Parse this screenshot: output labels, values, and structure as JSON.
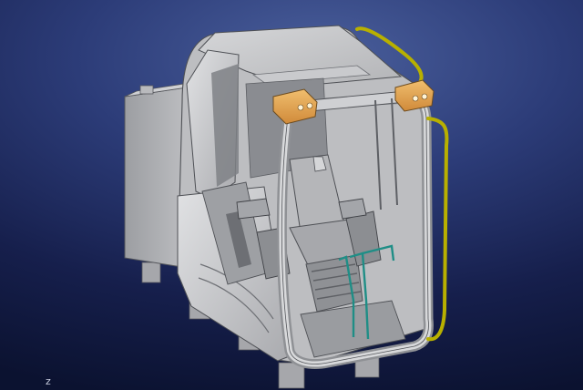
{
  "app": {
    "window_title": ""
  },
  "viewport": {
    "background_top": "#4a5f9c",
    "background_bottom": "#0b1230",
    "model": "operator-cab-assembly"
  },
  "compass": {
    "axis_label": "z"
  },
  "colors": {
    "body_gray": "#c4c5c8",
    "shadow_gray": "#8e9094",
    "light_housing": "#e3a652",
    "rail_yellow": "#b8b000",
    "hose_teal": "#1f8e86"
  }
}
